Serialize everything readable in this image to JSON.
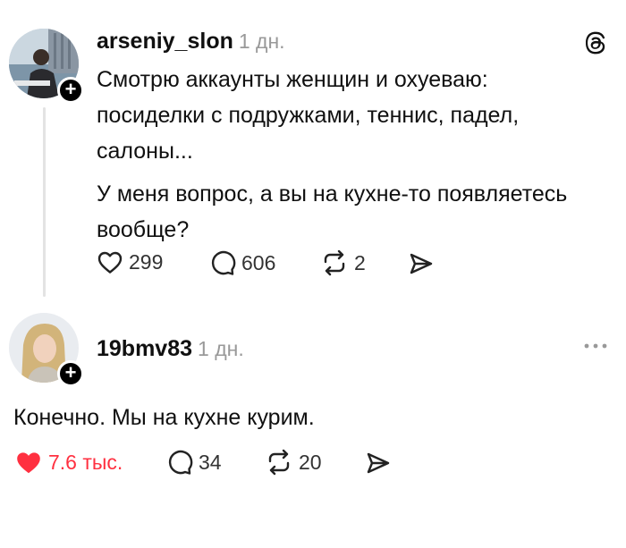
{
  "post": {
    "username": "arseniy_slon",
    "time": "1 дн.",
    "line1": "Смотрю аккаунты женщин и охуеваю:",
    "line2": "посиделки с подружками, теннис, падел,",
    "line3": "салоны...",
    "line4": "У меня вопрос, а вы на кухне-то появляетесь",
    "line5": "вообще?",
    "likes": "299",
    "comments": "606",
    "reposts": "2"
  },
  "reply": {
    "username": "19bmv83",
    "time": "1 дн.",
    "text": "Конечно. Мы на кухне курим.",
    "likes": "7.6 тыс.",
    "comments": "34",
    "reposts": "20"
  },
  "colors": {
    "like_active": "#ff3040",
    "muted": "#999999",
    "text": "#101010"
  }
}
